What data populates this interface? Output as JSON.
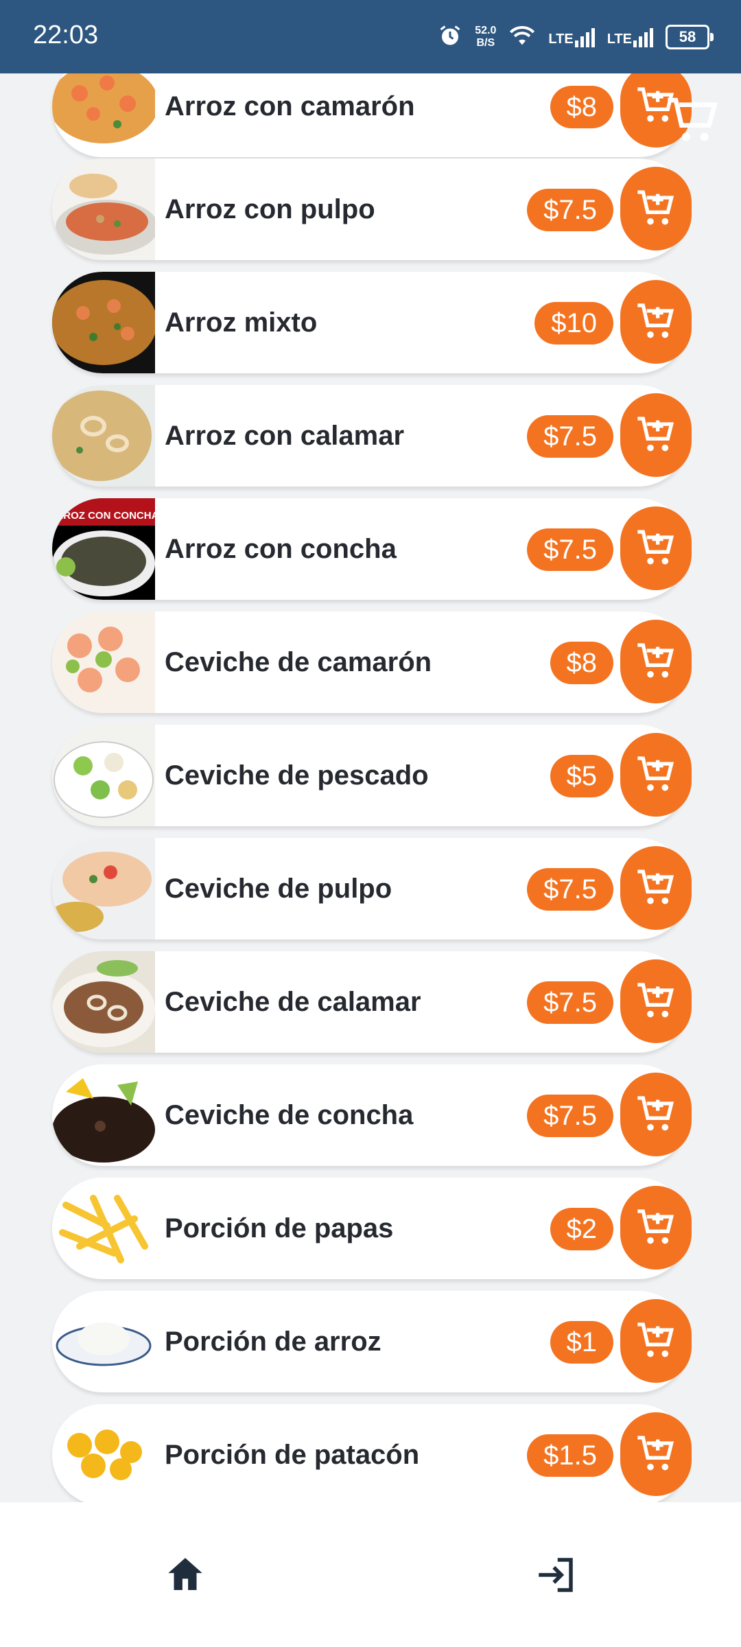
{
  "status_bar": {
    "time": "22:03",
    "net_speed_value": "52.0",
    "net_speed_unit": "B/S",
    "lte1": "LTE",
    "lte2": "LTE",
    "battery": "58",
    "icons": [
      "alarm-icon",
      "wifi-icon",
      "signal-icon",
      "signal-icon",
      "battery-icon"
    ]
  },
  "colors": {
    "status_bar": "#2d5680",
    "accent": "#f37321",
    "background": "#f1f2f4",
    "text": "#262a30"
  },
  "menu": {
    "items": [
      {
        "name": "Arroz con camarón",
        "price": "$8"
      },
      {
        "name": "Arroz con pulpo",
        "price": "$7.5"
      },
      {
        "name": "Arroz mixto",
        "price": "$10"
      },
      {
        "name": "Arroz con calamar",
        "price": "$7.5"
      },
      {
        "name": "Arroz con concha",
        "price": "$7.5",
        "image_text": "ARROZ CON CONCHA"
      },
      {
        "name": "Ceviche de camarón",
        "price": "$8"
      },
      {
        "name": "Ceviche de pescado",
        "price": "$5"
      },
      {
        "name": "Ceviche de pulpo",
        "price": "$7.5"
      },
      {
        "name": "Ceviche de calamar",
        "price": "$7.5"
      },
      {
        "name": "Ceviche de concha",
        "price": "$7.5"
      },
      {
        "name": "Porción de papas",
        "price": "$2"
      },
      {
        "name": "Porción de arroz",
        "price": "$1"
      },
      {
        "name": "Porción de patacón",
        "price": "$1.5"
      }
    ],
    "add_icon": "add-to-cart-icon"
  },
  "bottom_nav": {
    "icons": [
      "home-icon",
      "logout-icon"
    ]
  }
}
